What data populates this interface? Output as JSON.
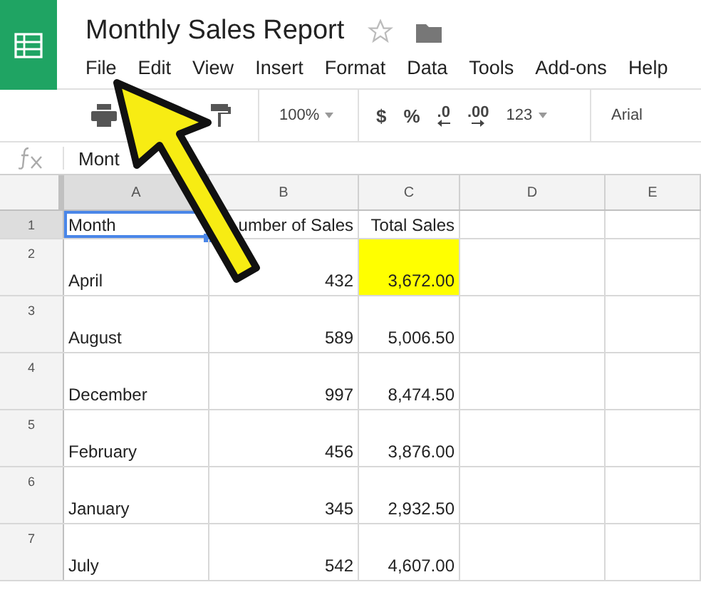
{
  "document": {
    "title": "Monthly Sales Report",
    "starred": false
  },
  "menu": [
    "File",
    "Edit",
    "View",
    "Insert",
    "Format",
    "Data",
    "Tools",
    "Add-ons",
    "Help"
  ],
  "toolbar": {
    "zoom": "100%",
    "currency": "$",
    "percent": "%",
    "decrease_decimals": ".0",
    "increase_decimals": ".00",
    "number_format": "123",
    "font": "Arial"
  },
  "formula_bar": {
    "value": "Mont"
  },
  "columns": [
    "A",
    "B",
    "C",
    "D",
    "E"
  ],
  "rows": [
    {
      "number": "1",
      "cells": [
        {
          "text": "Month",
          "selected": true,
          "highlighted": false
        },
        {
          "text": "umber of Sales",
          "selected": false,
          "highlighted": false
        },
        {
          "text": "Total Sales",
          "selected": false,
          "highlighted": false
        }
      ]
    },
    {
      "number": "2",
      "cells": [
        {
          "text": "April",
          "selected": false,
          "highlighted": false
        },
        {
          "text": "432",
          "selected": false,
          "highlighted": false
        },
        {
          "text": "3,672.00",
          "selected": false,
          "highlighted": true
        }
      ]
    },
    {
      "number": "3",
      "cells": [
        {
          "text": "August",
          "selected": false,
          "highlighted": false
        },
        {
          "text": "589",
          "selected": false,
          "highlighted": false
        },
        {
          "text": "5,006.50",
          "selected": false,
          "highlighted": false
        }
      ]
    },
    {
      "number": "4",
      "cells": [
        {
          "text": "December",
          "selected": false,
          "highlighted": false
        },
        {
          "text": "997",
          "selected": false,
          "highlighted": false
        },
        {
          "text": "8,474.50",
          "selected": false,
          "highlighted": false
        }
      ]
    },
    {
      "number": "5",
      "cells": [
        {
          "text": "February",
          "selected": false,
          "highlighted": false
        },
        {
          "text": "456",
          "selected": false,
          "highlighted": false
        },
        {
          "text": "3,876.00",
          "selected": false,
          "highlighted": false
        }
      ]
    },
    {
      "number": "6",
      "cells": [
        {
          "text": "January",
          "selected": false,
          "highlighted": false
        },
        {
          "text": "345",
          "selected": false,
          "highlighted": false
        },
        {
          "text": "2,932.50",
          "selected": false,
          "highlighted": false
        }
      ]
    },
    {
      "number": "7",
      "cells": [
        {
          "text": "July",
          "selected": false,
          "highlighted": false
        },
        {
          "text": "542",
          "selected": false,
          "highlighted": false
        },
        {
          "text": "4,607.00",
          "selected": false,
          "highlighted": false
        }
      ]
    }
  ]
}
